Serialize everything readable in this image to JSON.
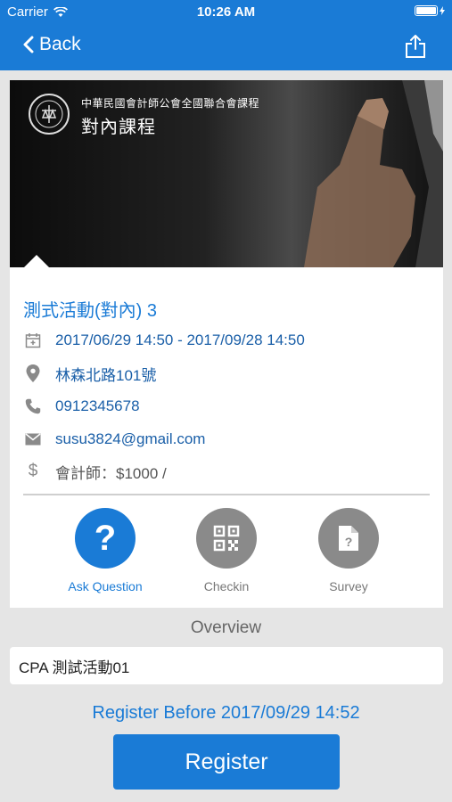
{
  "status_bar": {
    "carrier": "Carrier",
    "time": "10:26 AM"
  },
  "nav": {
    "back_label": "Back"
  },
  "banner": {
    "subtitle": "中華民國會計師公會全國聯合會課程",
    "title": "對內課程"
  },
  "event": {
    "title": "測式活動(對內) 3",
    "datetime": "2017/06/29 14:50 - 2017/09/28 14:50",
    "location": "林森北路101號",
    "phone": "0912345678",
    "email": "susu3824@gmail.com",
    "price": "會計師：$1000 /"
  },
  "actions": [
    {
      "label": "Ask Question"
    },
    {
      "label": "Checkin"
    },
    {
      "label": "Survey"
    }
  ],
  "overview": {
    "label": "Overview",
    "content": "CPA 測試活動01"
  },
  "register": {
    "before_text": "Register Before 2017/09/29 14:52",
    "button_label": "Register"
  },
  "colors": {
    "accent": "#1a7bd6",
    "icon_gray": "#8a8a8a",
    "background": "#e5e5e5"
  }
}
